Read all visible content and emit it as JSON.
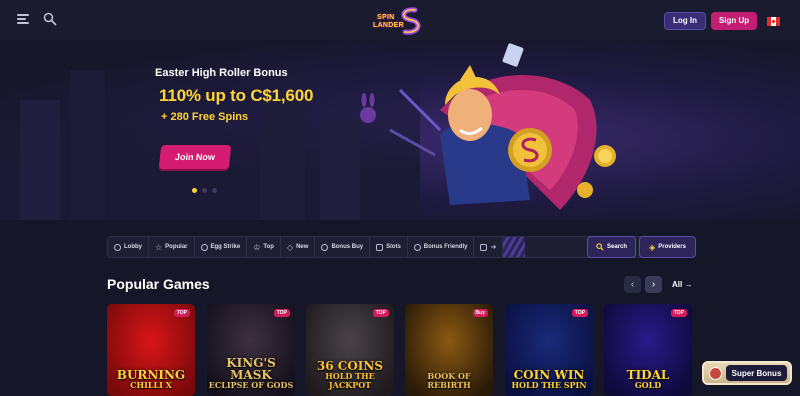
{
  "header": {
    "logo_line1": "SPIN",
    "logo_line2": "LANDER",
    "login_label": "Log In",
    "signup_label": "Sign Up",
    "flag_icon": "canada-flag-icon"
  },
  "hero": {
    "title": "Easter High Roller Bonus",
    "amount": "110% up to C$1,600",
    "spins": "+ 280 Free Spins",
    "cta_label": "Join Now",
    "slides": 3,
    "active_slide": 1
  },
  "nav": {
    "items": [
      {
        "label": "Lobby",
        "icon": "lobby-icon"
      },
      {
        "label": "Popular",
        "icon": "star-icon"
      },
      {
        "label": "Egg Strike",
        "icon": "egg-icon"
      },
      {
        "label": "Top",
        "icon": "crown-icon"
      },
      {
        "label": "New",
        "icon": "tag-icon"
      },
      {
        "label": "Bonus Buy",
        "icon": "coins-icon"
      },
      {
        "label": "Slots",
        "icon": "slots-icon"
      },
      {
        "label": "Bonus Friendly",
        "icon": "gift-icon"
      }
    ],
    "search_label": "Search",
    "providers_label": "Providers"
  },
  "popular": {
    "title": "Popular Games",
    "all_label": "All",
    "games": [
      {
        "line1": "BURNING",
        "line2": "CHILLI X",
        "badge": "TOP",
        "bg1": "#d8151a",
        "bg2": "#7a0a0a",
        "color": "#ffd43a"
      },
      {
        "line1": "KING'S MASK",
        "line2": "ECLIPSE OF GODS",
        "badge": "TOP",
        "bg1": "#3d3040",
        "bg2": "#14101c",
        "color": "#e8c36a"
      },
      {
        "line1": "36 COINS",
        "line2": "HOLD THE JACKPOT",
        "badge": "TOP",
        "bg1": "#4a4448",
        "bg2": "#1e1a1e",
        "color": "#ffc23a"
      },
      {
        "line1": "",
        "line2": "BOOK OF REBIRTH",
        "badge": "Buy",
        "bg1": "#8a5a12",
        "bg2": "#2a1a08",
        "color": "#f0c25a"
      },
      {
        "line1": "COIN WIN",
        "line2": "HOLD THE SPIN",
        "badge": "TOP",
        "bg1": "#1a2a7a",
        "bg2": "#0a1040",
        "color": "#ffd43a"
      },
      {
        "line1": "TIDAL",
        "line2": "GOLD",
        "badge": "TOP",
        "bg1": "#2a1a8a",
        "bg2": "#0e0a3a",
        "color": "#ffd43a"
      }
    ]
  },
  "super_bonus_label": "Super Bonus"
}
